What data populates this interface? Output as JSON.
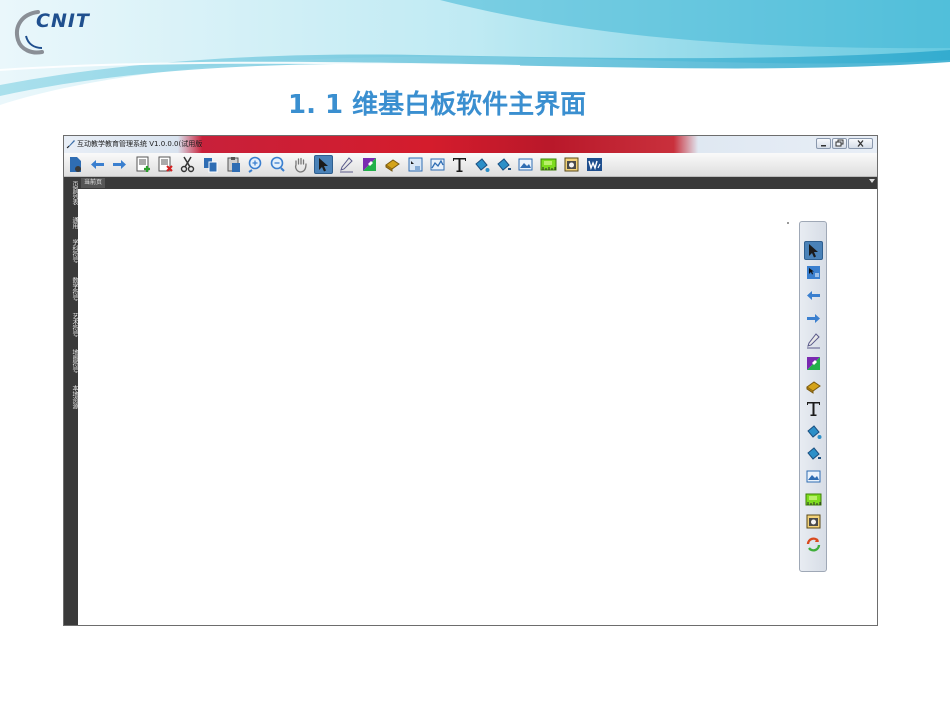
{
  "slide": {
    "logo_text": "CNIT",
    "title": "1. 1  维基白板软件主界面"
  },
  "app": {
    "window_title": "互动教学教育管理系统 V1.0.0.0(试用版",
    "window_controls": [
      "minimize-icon",
      "restore-icon",
      "close-icon"
    ],
    "toolbar_icons": [
      "new-page-icon",
      "undo-arrow-icon",
      "redo-arrow-icon",
      "add-page-icon",
      "delete-page-icon",
      "scissors-icon",
      "copy-icon",
      "paste-icon",
      "zoom-in-icon",
      "zoom-out-icon",
      "hand-pan-icon",
      "select-pointer-icon",
      "pen-icon",
      "color-palette-icon",
      "eraser-icon",
      "screen-capture-icon",
      "chart-icon",
      "text-icon",
      "fill-bucket-icon",
      "fill-bucket-alt-icon",
      "image-icon",
      "ruler-icon",
      "camera-icon",
      "wiki-icon"
    ],
    "active_tool": "select-pointer-icon",
    "sidebar_tabs": [
      "页面列表",
      "通用",
      "学科符号",
      "数学符号",
      "艺术符号",
      "地图符号",
      "本地资源"
    ],
    "page_tab": "当前页",
    "float_toolbar_icons": [
      "select-pointer-icon",
      "page-select-icon",
      "undo-arrow-icon",
      "redo-arrow-icon",
      "pen-icon",
      "color-palette-icon",
      "eraser-icon",
      "text-icon",
      "fill-bucket-icon",
      "fill-bucket-alt-icon",
      "image-icon",
      "ruler-icon",
      "camera-icon",
      "refresh-icon"
    ]
  },
  "colors": {
    "title_blue": "#3a8fd0",
    "logo_blue": "#1f4f8e",
    "titlebar_red": "#d41c2c",
    "sidebar_dark": "#3a3a3a"
  }
}
